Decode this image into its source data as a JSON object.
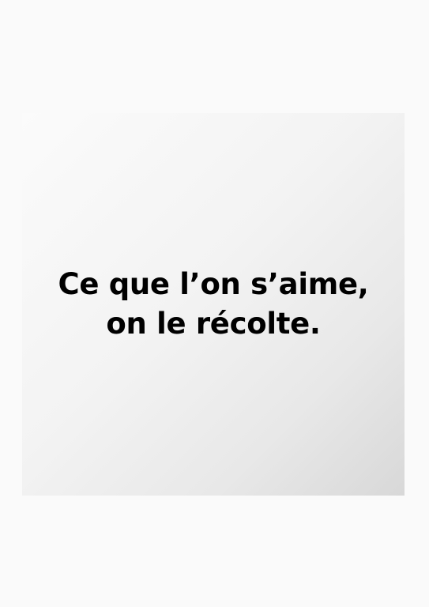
{
  "poster": {
    "quote_lines": [
      "Ce que l’on s’aime,",
      "on le récolte."
    ]
  }
}
